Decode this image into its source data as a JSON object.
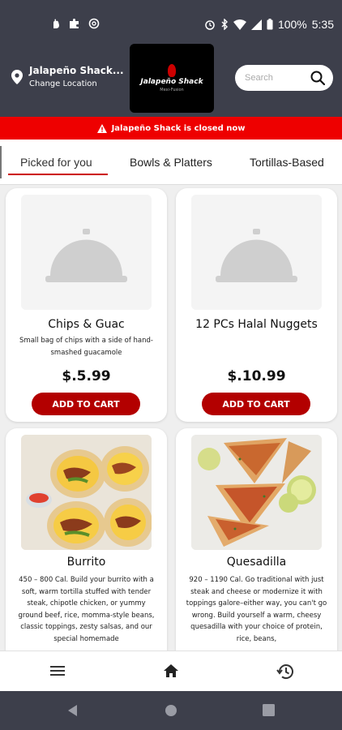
{
  "status_bar": {
    "battery": "100%",
    "time": "5:35"
  },
  "header": {
    "location_name": "Jalapeño Shack...",
    "change_location": "Change Location",
    "logo_text": "Jalapeño Shack",
    "logo_subtext": "Mexi-Fusion",
    "search_placeholder": "Search"
  },
  "banner": {
    "text": "Jalapeño Shack is closed now"
  },
  "tabs": [
    {
      "label": "Picked for you",
      "active": true
    },
    {
      "label": "Bowls & Platters",
      "active": false
    },
    {
      "label": "Tortillas-Based",
      "active": false
    }
  ],
  "menu_items": [
    {
      "title": "Chips & Guac",
      "description": "Small bag of chips with a side of hand-smashed guacamole",
      "price": "$.5.99",
      "button": "ADD TO CART",
      "image": "placeholder-cloche-icon"
    },
    {
      "title": "12 PCs Halal Nuggets",
      "description": "",
      "price": "$.10.99",
      "button": "ADD TO CART",
      "image": "placeholder-cloche-icon"
    },
    {
      "title": "Burrito",
      "description": "450 – 800 Cal. Build your burrito with a soft, warm tortilla stuffed with tender steak, chipotle chicken, or yummy ground beef, rice, momma-style beans, classic toppings, zesty salsas, and our special homemade",
      "image": "burrito-photo"
    },
    {
      "title": "Quesadilla",
      "description": "920 – 1190 Cal. Go traditional with just steak and cheese or modernize it with toppings galore–either way, you can't go wrong. Build yourself a warm, cheesy quesadilla with your choice of protein, rice, beans,",
      "image": "quesadilla-photo"
    }
  ],
  "bottom_nav": [
    {
      "icon": "menu-icon"
    },
    {
      "icon": "home-icon"
    },
    {
      "icon": "history-icon"
    }
  ],
  "colors": {
    "header_bg": "#3d3f4b",
    "banner_red": "#ee0000",
    "button_red": "#b30000",
    "tab_underline": "#cc0000"
  }
}
